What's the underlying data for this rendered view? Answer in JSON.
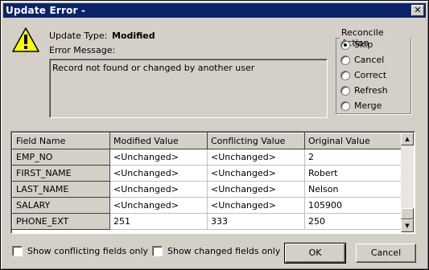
{
  "window": {
    "title": "Update Error -",
    "close_glyph": "✕"
  },
  "icon": {
    "name": "warning-icon",
    "color": "#ffff00"
  },
  "update_type": {
    "label": "Update Type:",
    "value": "Modified"
  },
  "error_message": {
    "label": "Error Message:",
    "text": "Record not found or changed by another user"
  },
  "reconcile": {
    "legend": "Reconcile Action",
    "options": [
      {
        "label": "Skip",
        "selected": true
      },
      {
        "label": "Cancel",
        "selected": false
      },
      {
        "label": "Correct",
        "selected": false
      },
      {
        "label": "Refresh",
        "selected": false
      },
      {
        "label": "Merge",
        "selected": false
      }
    ]
  },
  "grid": {
    "columns": [
      "Field Name",
      "Modified Value",
      "Conflicting Value",
      "Original Value"
    ],
    "rows": [
      [
        "EMP_NO",
        "<Unchanged>",
        "<Unchanged>",
        "2"
      ],
      [
        "FIRST_NAME",
        "<Unchanged>",
        "<Unchanged>",
        "Robert"
      ],
      [
        "LAST_NAME",
        "<Unchanged>",
        "<Unchanged>",
        "Nelson"
      ],
      [
        "SALARY",
        "<Unchanged>",
        "<Unchanged>",
        "105900"
      ],
      [
        "PHONE_EXT",
        "251",
        "333",
        "250"
      ]
    ],
    "scroll_up_glyph": "▲",
    "scroll_down_glyph": "▼"
  },
  "options": {
    "show_conflicting": {
      "label": "Show conflicting fields only",
      "checked": false
    },
    "show_changed": {
      "label": "Show changed fields only",
      "checked": false
    }
  },
  "buttons": {
    "ok": "OK",
    "cancel": "Cancel"
  },
  "colors": {
    "titlebar": "#0a246a",
    "face": "#d4d0c8"
  }
}
